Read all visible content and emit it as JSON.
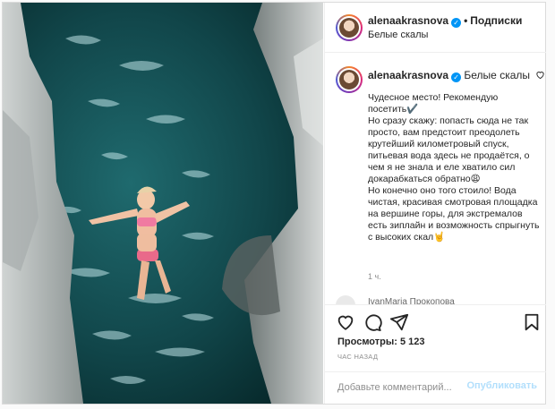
{
  "post": {
    "username": "alenaakrasnova",
    "location": "Белые скалы",
    "follow_label": "Подписки",
    "separator": "•"
  },
  "caption": {
    "username": "alenaakrasnova",
    "location": "Белые скалы",
    "text": "Чудесное место! Рекомендую посетить✔️\nНо сразу скажу: попасть сюда не так просто, вам предстоит преодолеть крутейший километровый спуск, питьевая вода здесь не продаётся, о чем я не знала и еле хватило сил докарабкаться обратно😩\nНо конечно оно того стоило! Вода чистая, красивая смотровая площадка на вершине горы, для экстремалов есть зиплайн и возможность спрыгнуть с высоких скал🤘",
    "time": "1 ч."
  },
  "comment_preview": "IvanMaria Прокопова",
  "stats": {
    "views_label": "Просмотры:",
    "views_count": "5 123",
    "time_ago": "час назад"
  },
  "comment_form": {
    "placeholder": "Добавьте комментарий...",
    "publish_label": "Опубликовать"
  },
  "icons": {
    "verified": "verified-badge-icon",
    "like": "heart-icon",
    "comment": "comment-icon",
    "share": "send-icon",
    "save": "bookmark-icon"
  },
  "colors": {
    "accent": "#0095f6",
    "publish_disabled": "#b2dffc",
    "water": "#0d3b3e"
  }
}
